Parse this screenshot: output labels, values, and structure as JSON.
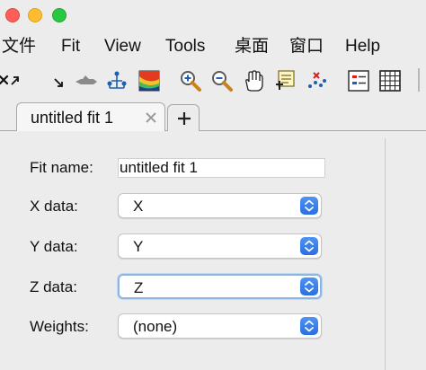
{
  "window": {
    "controls": [
      "close",
      "minimize",
      "zoom"
    ]
  },
  "menubar": {
    "items": [
      "文件",
      "Fit",
      "View",
      "Tools",
      "桌面",
      "窗口",
      "Help"
    ]
  },
  "toolbar": {
    "icons": [
      "exclude-arrows-icon",
      "rotate-icon",
      "pan-plot-icon",
      "data-cursor-tree-icon",
      "colormap-icon",
      "zoom-in-icon",
      "zoom-out-icon",
      "pan-hand-icon",
      "legend-exclude-icon",
      "exclude-outliers-icon",
      "legend-icon",
      "grid-icon"
    ]
  },
  "tabs": {
    "active": {
      "title": "untitled fit 1"
    },
    "add_label": "+"
  },
  "form": {
    "fit_name": {
      "label": "Fit name:",
      "value": "untitled fit 1"
    },
    "x_data": {
      "label": "X data:",
      "value": "X"
    },
    "y_data": {
      "label": "Y data:",
      "value": "Y"
    },
    "z_data": {
      "label": "Z data:",
      "value": "Z"
    },
    "weights": {
      "label": "Weights:",
      "value": "(none)"
    }
  },
  "colors": {
    "accent": "#2f7bf0",
    "focus_ring": "#8fb4e2",
    "background": "#ececec",
    "close": "#fe5f57",
    "minimize": "#febc2e",
    "zoom": "#28c840"
  }
}
